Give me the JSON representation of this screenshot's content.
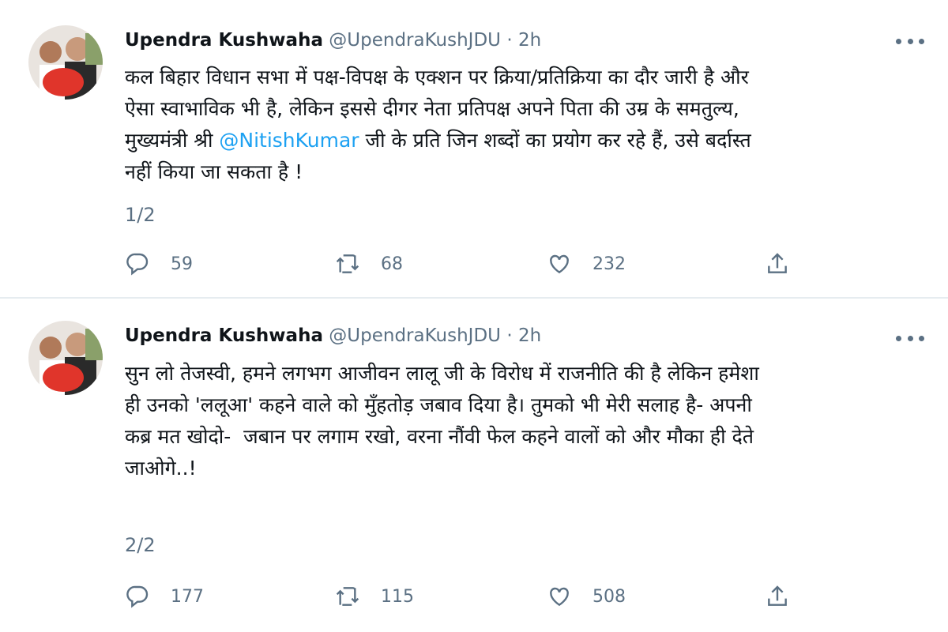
{
  "tweets": [
    {
      "name": "Upendra Kushwaha",
      "handle": "@UpendraKushJDU",
      "separator": "·",
      "time": "2h",
      "text_before_mention": "कल बिहार विधान सभा में पक्ष-विपक्ष के एक्शन पर क्रिया/प्रतिक्रिया का दौर जारी है और\nऐसा स्वाभाविक भी है, लेकिन इससे दीगर नेता प्रतिपक्ष अपने पिता की उम्र के समतुल्य,\nमुख्यमंत्री श्री ",
      "mention": "@NitishKumar",
      "text_after_mention": " जी के प्रति जिन शब्दों का प्रयोग कर रहे हैं, उसे बर्दास्त\nनहीं किया जा सकता है !",
      "counter": "1/2",
      "replies": "59",
      "retweets": "68",
      "likes": "232"
    },
    {
      "name": "Upendra Kushwaha",
      "handle": "@UpendraKushJDU",
      "separator": "·",
      "time": "2h",
      "text": "सुन लो तेजस्वी, हमने लगभग आजीवन लालू जी के विरोध में राजनीति की है लेकिन हमेशा\nही उनको 'ललूआ' कहने वाले को मुँहतोड़ जबाव दिया है। तुमको भी मेरी सलाह है- अपनी\nकब्र मत खोदो-  जबान पर लगाम रखो, वरना नौंवी फेल कहने वालों को और मौका ही देते\nजाओगे..!",
      "counter": "2/2",
      "replies": "177",
      "retweets": "115",
      "likes": "508"
    }
  ],
  "icons": {
    "reply": "reply-icon",
    "retweet": "retweet-icon",
    "like": "like-icon",
    "share": "share-icon",
    "more": "more-icon"
  },
  "colors": {
    "text": "#0f1419",
    "secondary": "#5b7083",
    "mention": "#1da1f2",
    "divider": "#e6ecf0"
  }
}
